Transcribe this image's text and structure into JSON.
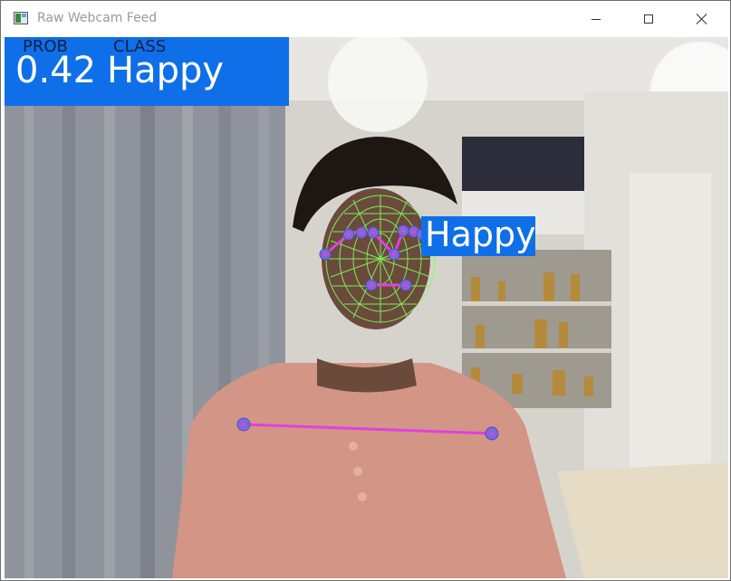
{
  "window": {
    "title": "Raw Webcam Feed",
    "icon": "opencv-window-icon",
    "controls": [
      "minimize-icon",
      "maximize-icon",
      "close-icon"
    ]
  },
  "overlay": {
    "prob_label": "PROB",
    "class_label": "CLASS",
    "prob_value": "0.42",
    "class_value": "Happy",
    "face_label": "Happy",
    "box_color": "#0f6fe8",
    "landmark_line_color": "#e040e0",
    "mesh_color": "#7cff5a"
  }
}
